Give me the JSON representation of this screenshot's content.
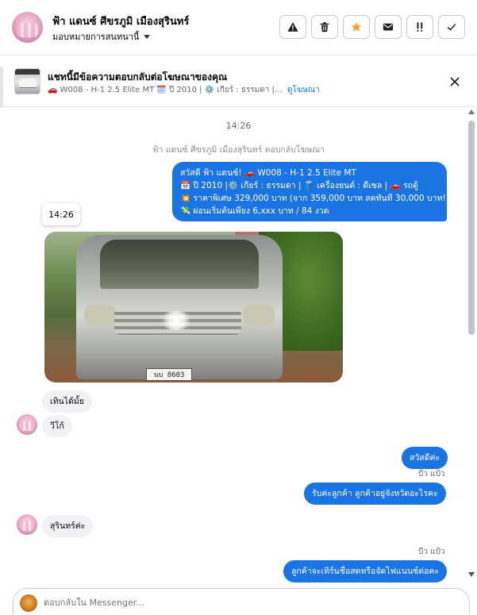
{
  "header": {
    "contact_name": "ฟ้า แดนซ์ ศีขรภูมิ เมืองสุรินทร์",
    "assign_label": "มอบหมายการสนทนานี้",
    "toolbar": [
      {
        "icon": "warning-icon",
        "name": "report-button"
      },
      {
        "icon": "trash-icon",
        "name": "delete-button"
      },
      {
        "icon": "star-icon",
        "name": "star-button"
      },
      {
        "icon": "mail-icon",
        "name": "mark-unread-button"
      },
      {
        "icon": "priority-icon",
        "name": "priority-button"
      },
      {
        "icon": "check-icon",
        "name": "done-button"
      }
    ]
  },
  "ad": {
    "title": "แชทนี้มีข้อความตอบกลับต่อโฆษณาของคุณ",
    "subtitle": "🚗 W008 - H-1 2.5 Elite MT 🗓️ ปี 2010 | ⚙️ เกียร์ : ธรรมดา | 🛢️ เครือง...",
    "link": "ดูโฆษณา"
  },
  "conversation": {
    "timestamp": "14:26",
    "system_note": "ฟ้า แดนซ์ ศีขรภูมิ เมืองสุรินทร์ ตอบกลับโฆษณา",
    "ad_reply_lines": [
      "สวัสดี ฟ้า แดนซ์! 🚗 W008 - H-1 2.5 Elite MT",
      "📅 ปี 2010 |⚙️ เกียร์ : ธรรมดา | 🛢️ เครื่องยนต์ : ดีเซล | 🚗 รถตู้",
      "💥 ราคาพิเศษ 329,000 บาท (จาก 359,000 บาท ลดทันที 30,000 บาท!)",
      "💸 ผ่อนเริ่มต้นเพียง 6,xxx บาท / 84 งวด"
    ],
    "hover_time": "14:26",
    "photo_plate": "นบ 8603",
    "msg_in_1": "เทินได้มั้ย",
    "msg_in_2": "วีโก้",
    "msg_out_1": "สวัสดีค่ะ",
    "seen_1": "บีว แป้ว",
    "msg_out_2": "รับค่ะลูกค้า   ลูกค้าอยู่จังหวัดอะไรคะ",
    "msg_in_3": "สุรินทร์ค่ะ",
    "seen_2": "บีว แป้ว",
    "msg_out_3": "ลูกค้าจะเทิร์นชื่อสดหรือจัดไฟแนนซ์ต่อคะ"
  },
  "composer": {
    "placeholder": "ตอบกลับใน Messenger..."
  },
  "colors": {
    "accent": "#1b74e4",
    "incoming_bubble": "#f0f2f5",
    "star": "#f7a23b"
  }
}
